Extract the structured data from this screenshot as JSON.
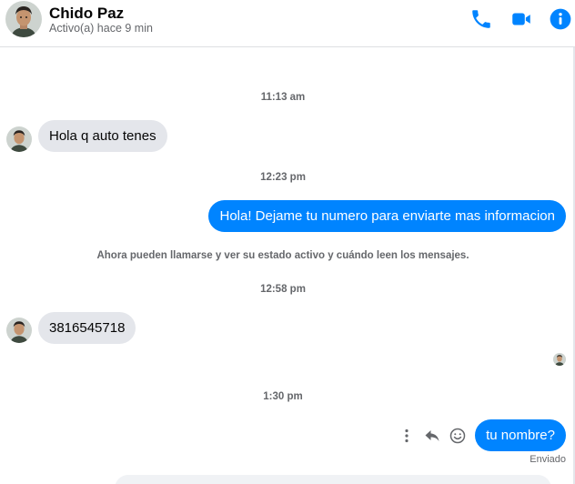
{
  "header": {
    "contact_name": "Chido Paz",
    "status": "Activo(a) hace 9 min",
    "actions": [
      "phone-icon",
      "video-icon",
      "info-icon"
    ],
    "accent_color": "#0084ff"
  },
  "messages": {
    "ts1": "11:13 am",
    "msg1": "Hola q auto tenes",
    "ts2": "12:23 pm",
    "msg2": "Hola! Dejame tu numero para enviarte mas informacion",
    "system_note": "Ahora pueden llamarse y ver su estado activo y cuándo leen los mensajes.",
    "ts3": "12:58 pm",
    "msg3": "3816545718",
    "ts4": "1:30 pm",
    "msg4": "tu nombre?",
    "sent_status": "Enviado"
  },
  "message_actions": [
    "more-vertical-icon",
    "reply-icon",
    "emoji-icon"
  ],
  "colors": {
    "incoming_bubble": "#e4e6eb",
    "outgoing_bubble": "#0084ff",
    "meta_text": "#65676b"
  }
}
